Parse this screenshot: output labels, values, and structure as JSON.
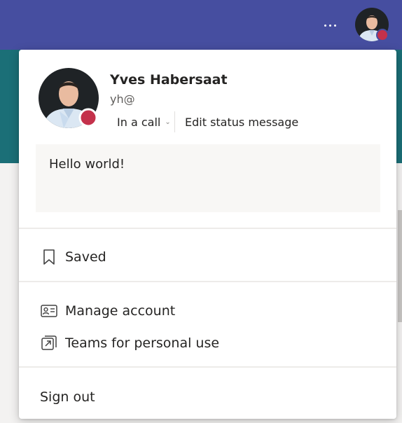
{
  "header": {
    "more_icon": "more-horizontal-icon",
    "avatar_icon": "user-avatar-photo"
  },
  "colors": {
    "header_bg": "#464ea0",
    "banner_bg": "#1b6f77",
    "presence_busy": "#c4314b",
    "panel_bg": "#ffffff",
    "status_box_bg": "#f8f7f5"
  },
  "profile": {
    "name": "Yves Habersaat",
    "handle": "yh@",
    "presence": "In a call",
    "presence_icon": "chevron-down-icon",
    "edit_status_label": "Edit status message",
    "status_message": "Hello world!"
  },
  "menu": {
    "saved": {
      "label": "Saved",
      "icon": "bookmark-icon"
    },
    "manage_account": {
      "label": "Manage account",
      "icon": "contact-card-icon"
    },
    "personal_use": {
      "label": "Teams for personal use",
      "icon": "open-external-icon"
    },
    "sign_out": {
      "label": "Sign out"
    }
  }
}
